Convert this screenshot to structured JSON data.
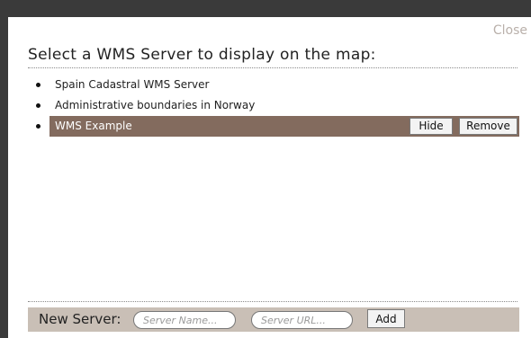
{
  "dialog": {
    "close_label": "Close",
    "title": "Select a WMS Server to display on the map:"
  },
  "servers": [
    {
      "name": "Spain Cadastral WMS Server",
      "selected": false
    },
    {
      "name": "Administrative boundaries in Norway",
      "selected": false
    },
    {
      "name": "WMS Example",
      "selected": true,
      "hide_label": "Hide",
      "remove_label": "Remove"
    }
  ],
  "new_server": {
    "label": "New Server:",
    "name_placeholder": "Server Name...",
    "url_placeholder": "Server URL...",
    "add_label": "Add"
  },
  "colors": {
    "selected_row": "#836b5e",
    "new_server_bar": "#c9bfb6",
    "close_link": "#b9b0aa"
  }
}
